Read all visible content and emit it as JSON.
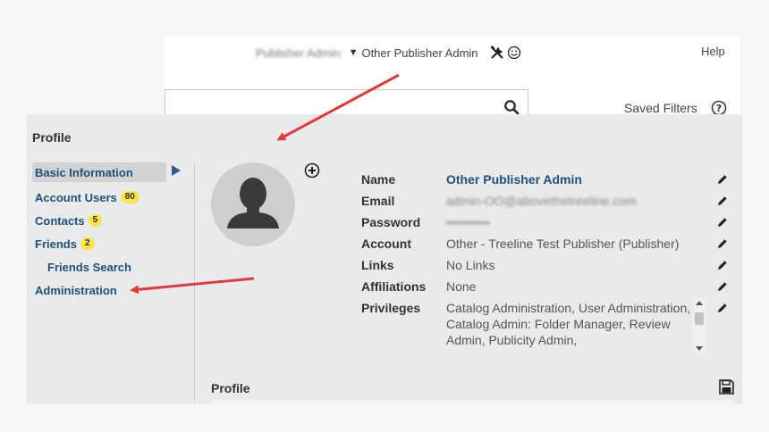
{
  "header": {
    "user_prefix": "Publisher Admin:",
    "user_name": "Other Publisher Admin",
    "tools_icon": "tools-icon",
    "smile_icon": "smiley-icon",
    "help_label": "Help"
  },
  "search": {
    "value": "",
    "saved_filters_label": "Saved Filters"
  },
  "panel": {
    "title": "Profile",
    "section_title": "Profile"
  },
  "nav": {
    "items": [
      {
        "label": "Basic Information"
      },
      {
        "label": "Account Users",
        "badge": "80"
      },
      {
        "label": "Contacts",
        "badge": "5"
      },
      {
        "label": "Friends",
        "badge": "2"
      },
      {
        "label": "Friends Search"
      },
      {
        "label": "Administration"
      }
    ]
  },
  "profile": {
    "rows": [
      {
        "label": "Name",
        "value": "Other Publisher Admin"
      },
      {
        "label": "Email",
        "value": "admin-OO@abovethetreeline.com"
      },
      {
        "label": "Password",
        "value": "••••••••••"
      },
      {
        "label": "Account",
        "value": "Other - Treeline Test Publisher (Publisher)"
      },
      {
        "label": "Links",
        "value": "No Links"
      },
      {
        "label": "Affiliations",
        "value": "None"
      },
      {
        "label": "Privileges",
        "value": "Catalog Administration, User Administration, Catalog Admin: Folder Manager, Review Admin, Publicity Admin,"
      }
    ]
  },
  "colors": {
    "nav_link": "#1f4f7a",
    "badge": "#ffe34d",
    "panel_bg": "#e9eaeb",
    "annotation_arrow": "#e0393e"
  }
}
